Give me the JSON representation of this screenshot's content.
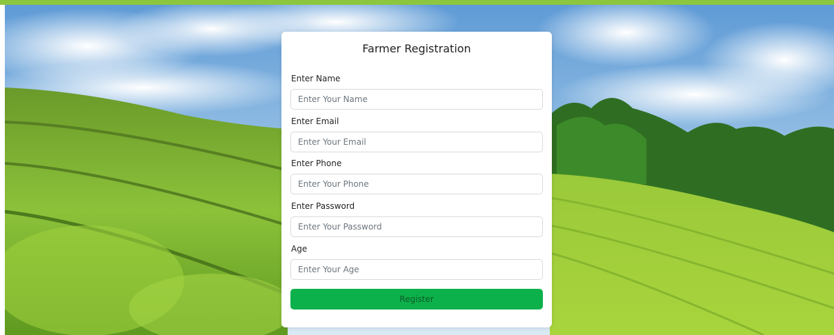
{
  "colors": {
    "accent_bar": "#8cc63f",
    "button_bg": "#0db14b",
    "button_text": "#0a5c26"
  },
  "background": {
    "description_icon": "tea-field-landscape"
  },
  "form": {
    "title": "Farmer Registration",
    "fields": [
      {
        "label": "Enter Name",
        "placeholder": "Enter Your Name",
        "value": ""
      },
      {
        "label": "Enter Email",
        "placeholder": "Enter Your Email",
        "value": ""
      },
      {
        "label": "Enter Phone",
        "placeholder": "Enter Your Phone",
        "value": ""
      },
      {
        "label": "Enter Password",
        "placeholder": "Enter Your Password",
        "value": ""
      },
      {
        "label": "Age",
        "placeholder": "Enter Your Age",
        "value": ""
      }
    ],
    "submit_label": "Register"
  }
}
